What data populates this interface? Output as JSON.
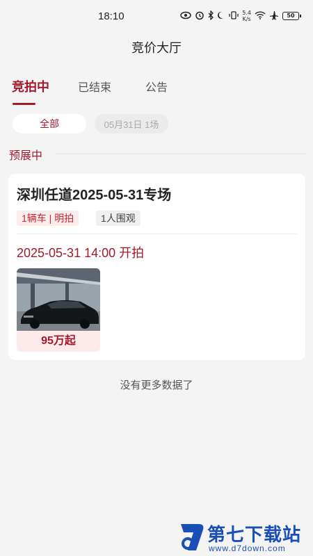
{
  "status_bar": {
    "time": "18:10",
    "speed_value": "5.4",
    "speed_unit": "K/s",
    "battery": "50",
    "icons": [
      "eye-icon",
      "alarm-icon",
      "bluetooth-icon",
      "moon-icon",
      "vibrate-icon",
      "wifi-icon",
      "airplane-icon",
      "battery-icon"
    ]
  },
  "header": {
    "title": "竞价大厅"
  },
  "tabs": [
    {
      "label": "竞拍中",
      "active": true
    },
    {
      "label": "已结束",
      "active": false
    },
    {
      "label": "公告",
      "active": false
    }
  ],
  "filters": {
    "all": "全部",
    "date": "05月31日 1场"
  },
  "section": {
    "title": "预展中"
  },
  "auction": {
    "title": "深圳任道2025-05-31专场",
    "tag_vehicle": "1辆车 | 明拍",
    "tag_watchers": "1人围观",
    "start_time": "2025-05-31 14:00 开拍",
    "car_price": "95万起"
  },
  "list_footer": "没有更多数据了",
  "watermark": {
    "name": "第七下载站",
    "url": "www.d7down.com"
  },
  "colors": {
    "accent": "#a3192b",
    "background": "#f4f4f4",
    "brand_watermark": "#1a4fb8"
  }
}
